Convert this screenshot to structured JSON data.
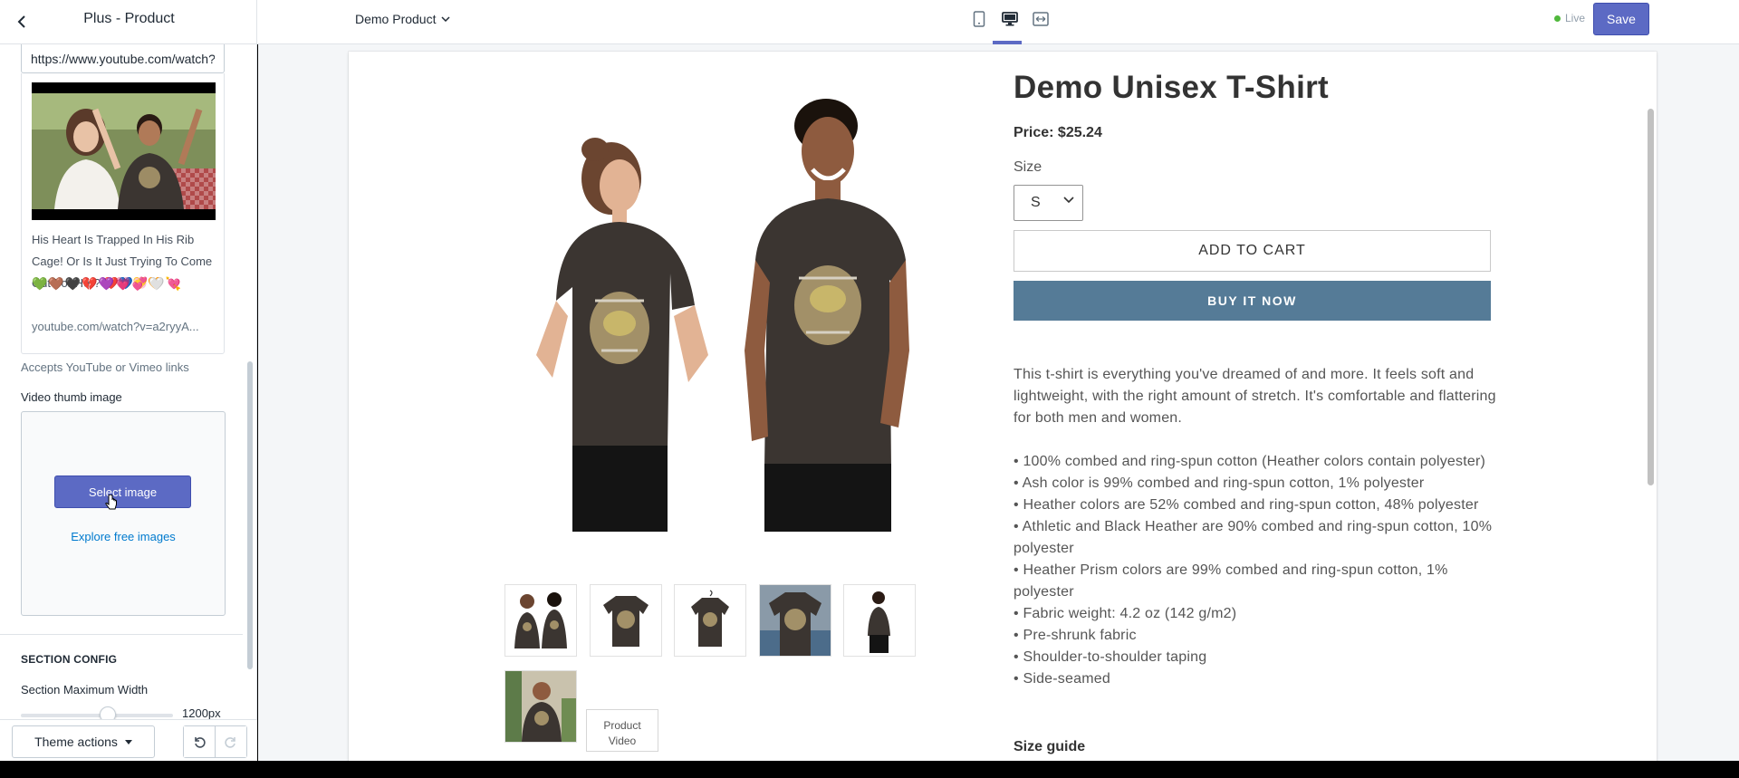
{
  "header": {
    "title": "Plus - Product",
    "page_selector": "Demo Product",
    "live_label": "Live",
    "save_label": "Save",
    "views": [
      "mobile-view-icon",
      "desktop-view-icon",
      "fullscreen-view-icon"
    ],
    "active_view": "desktop"
  },
  "sidebar": {
    "video_url_value": "https://www.youtube.com/watch?",
    "video_title": "His Heart Is Trapped In His Rib Cage! Or Is It Just Trying To Come Out For Her?",
    "video_title_emojis": "❤️💙💛🧡",
    "video_emojis_line2": "💚🤎🖤💔💜💗💞🤍💘",
    "video_url_short": "youtube.com/watch?v=a2ryyA...",
    "help_text": "Accepts YouTube or Vimeo links",
    "thumb_label": "Video thumb image",
    "select_image_label": "Select image",
    "explore_label": "Explore free images",
    "section_heading": "SECTION CONFIG",
    "max_width_label": "Section Maximum Width",
    "max_width_value": "1200px",
    "max_width_fraction": 0.55,
    "theme_actions_label": "Theme actions"
  },
  "product": {
    "title": "Demo Unisex T-Shirt",
    "price": "Price: $25.24",
    "size_label": "Size",
    "size_value": "S",
    "add_to_cart_label": "ADD TO CART",
    "buy_now_label": "BUY IT NOW",
    "intro": "This t-shirt is everything you've dreamed of and more. It feels soft and lightweight, with the right amount of stretch. It's comfortable and flattering for both men and women.",
    "bullets": [
      "• 100% combed and ring-spun cotton (Heather colors contain polyester)",
      "• Ash color is 99% combed and ring-spun cotton, 1% polyester",
      "• Heather colors are 52% combed and ring-spun cotton, 48% polyester",
      "• Athletic and Black Heather are 90% combed and ring-spun cotton, 10% polyester",
      "• Heather Prism colors are 99% combed and ring-spun cotton, 1% polyester",
      "• Fabric weight: 4.2 oz (142 g/m2)",
      "• Pre-shrunk fabric",
      "• Shoulder-to-shoulder taping",
      "• Side-seamed"
    ],
    "size_guide": "Size guide",
    "product_video_label_1": "Product",
    "product_video_label_2": "Video"
  },
  "colors": {
    "accent": "#5c6ac4",
    "buy_now": "#557b97",
    "live_dot": "#50b83c",
    "shirt": "#3b3531"
  }
}
